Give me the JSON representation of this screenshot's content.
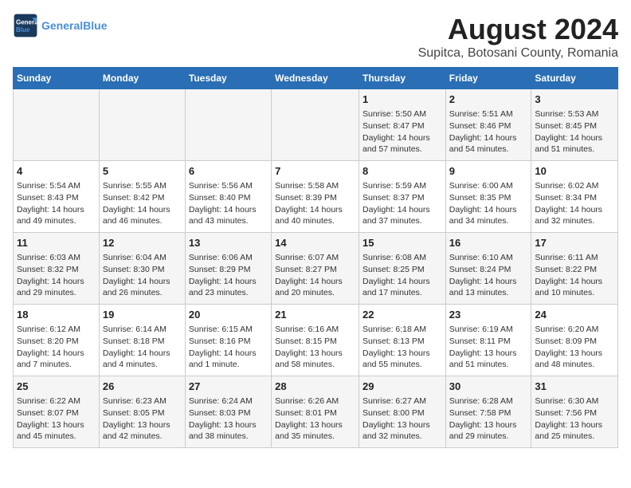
{
  "logo": {
    "line1": "General",
    "line2": "Blue"
  },
  "title": "August 2024",
  "subtitle": "Supitca, Botosani County, Romania",
  "headers": [
    "Sunday",
    "Monday",
    "Tuesday",
    "Wednesday",
    "Thursday",
    "Friday",
    "Saturday"
  ],
  "weeks": [
    [
      {
        "day": "",
        "info": ""
      },
      {
        "day": "",
        "info": ""
      },
      {
        "day": "",
        "info": ""
      },
      {
        "day": "",
        "info": ""
      },
      {
        "day": "1",
        "info": "Sunrise: 5:50 AM\nSunset: 8:47 PM\nDaylight: 14 hours\nand 57 minutes."
      },
      {
        "day": "2",
        "info": "Sunrise: 5:51 AM\nSunset: 8:46 PM\nDaylight: 14 hours\nand 54 minutes."
      },
      {
        "day": "3",
        "info": "Sunrise: 5:53 AM\nSunset: 8:45 PM\nDaylight: 14 hours\nand 51 minutes."
      }
    ],
    [
      {
        "day": "4",
        "info": "Sunrise: 5:54 AM\nSunset: 8:43 PM\nDaylight: 14 hours\nand 49 minutes."
      },
      {
        "day": "5",
        "info": "Sunrise: 5:55 AM\nSunset: 8:42 PM\nDaylight: 14 hours\nand 46 minutes."
      },
      {
        "day": "6",
        "info": "Sunrise: 5:56 AM\nSunset: 8:40 PM\nDaylight: 14 hours\nand 43 minutes."
      },
      {
        "day": "7",
        "info": "Sunrise: 5:58 AM\nSunset: 8:39 PM\nDaylight: 14 hours\nand 40 minutes."
      },
      {
        "day": "8",
        "info": "Sunrise: 5:59 AM\nSunset: 8:37 PM\nDaylight: 14 hours\nand 37 minutes."
      },
      {
        "day": "9",
        "info": "Sunrise: 6:00 AM\nSunset: 8:35 PM\nDaylight: 14 hours\nand 34 minutes."
      },
      {
        "day": "10",
        "info": "Sunrise: 6:02 AM\nSunset: 8:34 PM\nDaylight: 14 hours\nand 32 minutes."
      }
    ],
    [
      {
        "day": "11",
        "info": "Sunrise: 6:03 AM\nSunset: 8:32 PM\nDaylight: 14 hours\nand 29 minutes."
      },
      {
        "day": "12",
        "info": "Sunrise: 6:04 AM\nSunset: 8:30 PM\nDaylight: 14 hours\nand 26 minutes."
      },
      {
        "day": "13",
        "info": "Sunrise: 6:06 AM\nSunset: 8:29 PM\nDaylight: 14 hours\nand 23 minutes."
      },
      {
        "day": "14",
        "info": "Sunrise: 6:07 AM\nSunset: 8:27 PM\nDaylight: 14 hours\nand 20 minutes."
      },
      {
        "day": "15",
        "info": "Sunrise: 6:08 AM\nSunset: 8:25 PM\nDaylight: 14 hours\nand 17 minutes."
      },
      {
        "day": "16",
        "info": "Sunrise: 6:10 AM\nSunset: 8:24 PM\nDaylight: 14 hours\nand 13 minutes."
      },
      {
        "day": "17",
        "info": "Sunrise: 6:11 AM\nSunset: 8:22 PM\nDaylight: 14 hours\nand 10 minutes."
      }
    ],
    [
      {
        "day": "18",
        "info": "Sunrise: 6:12 AM\nSunset: 8:20 PM\nDaylight: 14 hours\nand 7 minutes."
      },
      {
        "day": "19",
        "info": "Sunrise: 6:14 AM\nSunset: 8:18 PM\nDaylight: 14 hours\nand 4 minutes."
      },
      {
        "day": "20",
        "info": "Sunrise: 6:15 AM\nSunset: 8:16 PM\nDaylight: 14 hours\nand 1 minute."
      },
      {
        "day": "21",
        "info": "Sunrise: 6:16 AM\nSunset: 8:15 PM\nDaylight: 13 hours\nand 58 minutes."
      },
      {
        "day": "22",
        "info": "Sunrise: 6:18 AM\nSunset: 8:13 PM\nDaylight: 13 hours\nand 55 minutes."
      },
      {
        "day": "23",
        "info": "Sunrise: 6:19 AM\nSunset: 8:11 PM\nDaylight: 13 hours\nand 51 minutes."
      },
      {
        "day": "24",
        "info": "Sunrise: 6:20 AM\nSunset: 8:09 PM\nDaylight: 13 hours\nand 48 minutes."
      }
    ],
    [
      {
        "day": "25",
        "info": "Sunrise: 6:22 AM\nSunset: 8:07 PM\nDaylight: 13 hours\nand 45 minutes."
      },
      {
        "day": "26",
        "info": "Sunrise: 6:23 AM\nSunset: 8:05 PM\nDaylight: 13 hours\nand 42 minutes."
      },
      {
        "day": "27",
        "info": "Sunrise: 6:24 AM\nSunset: 8:03 PM\nDaylight: 13 hours\nand 38 minutes."
      },
      {
        "day": "28",
        "info": "Sunrise: 6:26 AM\nSunset: 8:01 PM\nDaylight: 13 hours\nand 35 minutes."
      },
      {
        "day": "29",
        "info": "Sunrise: 6:27 AM\nSunset: 8:00 PM\nDaylight: 13 hours\nand 32 minutes."
      },
      {
        "day": "30",
        "info": "Sunrise: 6:28 AM\nSunset: 7:58 PM\nDaylight: 13 hours\nand 29 minutes."
      },
      {
        "day": "31",
        "info": "Sunrise: 6:30 AM\nSunset: 7:56 PM\nDaylight: 13 hours\nand 25 minutes."
      }
    ]
  ]
}
